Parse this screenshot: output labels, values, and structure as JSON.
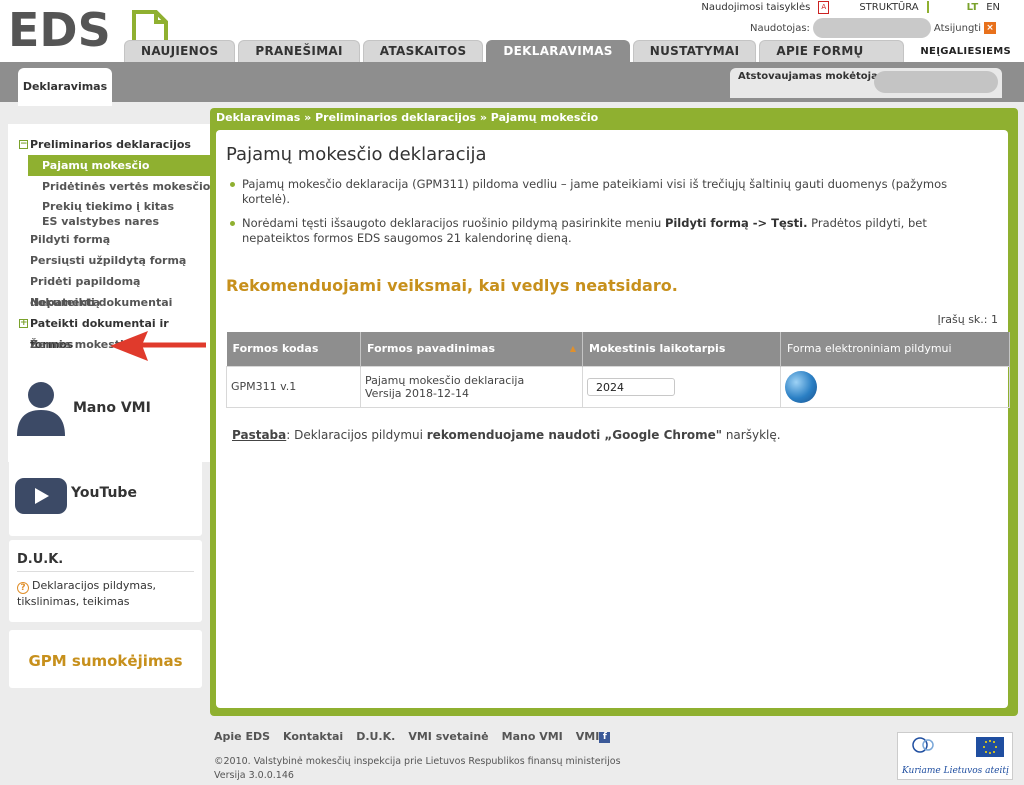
{
  "header": {
    "logo_text": "EDS",
    "rules_link": "Naudojimosi taisyklės",
    "structure_link": "STRUKTŪRA",
    "lang_lt": "LT",
    "lang_en": "EN",
    "user_label": "Naudotojas:",
    "logout": "Atsijungti",
    "tabs": [
      {
        "label": "NAUJIENOS"
      },
      {
        "label": "PRANEŠIMAI"
      },
      {
        "label": "ATASKAITOS"
      },
      {
        "label": "DEKLARAVIMAS"
      },
      {
        "label": "NUSTATYMAI"
      },
      {
        "label": "APIE FORMŲ TEIKIMĄ"
      },
      {
        "label": "NEĮGALIESIEMS"
      }
    ],
    "subtab": "Deklaravimas",
    "payer_label": "Atstovaujamas mokėtojas:"
  },
  "sidebar": {
    "menu": [
      {
        "label": "Preliminarios deklaracijos",
        "kind": "group",
        "sign": "−"
      },
      {
        "label": "Pajamų mokesčio",
        "kind": "active"
      },
      {
        "label": "Pridėtinės vertės mokesčio",
        "kind": "sub"
      },
      {
        "label": "Prekių tiekimo į kitas ES valstybes nares",
        "kind": "sub2"
      },
      {
        "label": "Pildyti formą",
        "kind": "plain"
      },
      {
        "label": "Persiųsti užpildytą formą",
        "kind": "plain"
      },
      {
        "label": "Pridėti papildomą dokumentą",
        "kind": "plain"
      },
      {
        "label": "Nepateikti dokumentai",
        "kind": "plain"
      },
      {
        "label": "Pateikti dokumentai ir formos",
        "kind": "group",
        "sign": "+"
      },
      {
        "label": "Žemės mokestis",
        "kind": "plain"
      }
    ],
    "mano_vmi": "Mano VMI",
    "youtube": "YouTube",
    "duk_title": "D.U.K.",
    "duk_text": "Deklaracijos pildymas, tikslinimas, teikimas",
    "gpm": "GPM sumokėjimas"
  },
  "main": {
    "breadcrumb": "Deklaravimas »  Preliminarios deklaracijos  » Pajamų mokesčio",
    "title": "Pajamų mokesčio deklaracija",
    "bullet1": "Pajamų mokesčio deklaracija (GPM311) pildoma vedliu – jame pateikiami visi iš trečiųjų šaltinių gauti duomenys (pažymos kortelė).",
    "bullet2_pre": "Norėdami tęsti išsaugoto deklaracijos ruošinio pildymą pasirinkite meniu ",
    "bullet2_bold": "Pildyti formą -> Tęsti.",
    "bullet2_post": " Pradėtos pildyti, bet nepateiktos formos EDS saugomos 21 kalendorinę dieną.",
    "recommend": "Rekomenduojami veiksmai, kai vedlys neatsidaro.",
    "count": "Įrašų sk.: 1",
    "table": {
      "headers": [
        "Formos kodas",
        "Formos pavadinimas",
        "Mokestinis laikotarpis",
        "Forma elektroniniam pildymui"
      ],
      "row": {
        "code": "GPM311 v.1",
        "name": "Pajamų mokesčio deklaracija",
        "version": "Versija 2018-12-14",
        "period": "2024"
      }
    },
    "note_label": "Pastaba",
    "note_pre": ": Deklaracijos pildymui ",
    "note_bold": "rekomenduojame naudoti „Google Chrome\"",
    "note_post": " naršyklę."
  },
  "footer": {
    "links": [
      "Apie EDS",
      "Kontaktai",
      "D.U.K.",
      "VMI svetainė",
      "Mano VMI",
      "VMI"
    ],
    "copyright": "©2010. Valstybinė mokesčių inspekcija prie Lietuvos Respublikos finansų ministerijos",
    "version": "Versija 3.0.0.146",
    "eu_slogan": "Kuriame Lietuvos ateitį"
  },
  "colors": {
    "accent": "#8fb030",
    "gold": "#c7901c",
    "tab_active": "#8e8e8e"
  }
}
